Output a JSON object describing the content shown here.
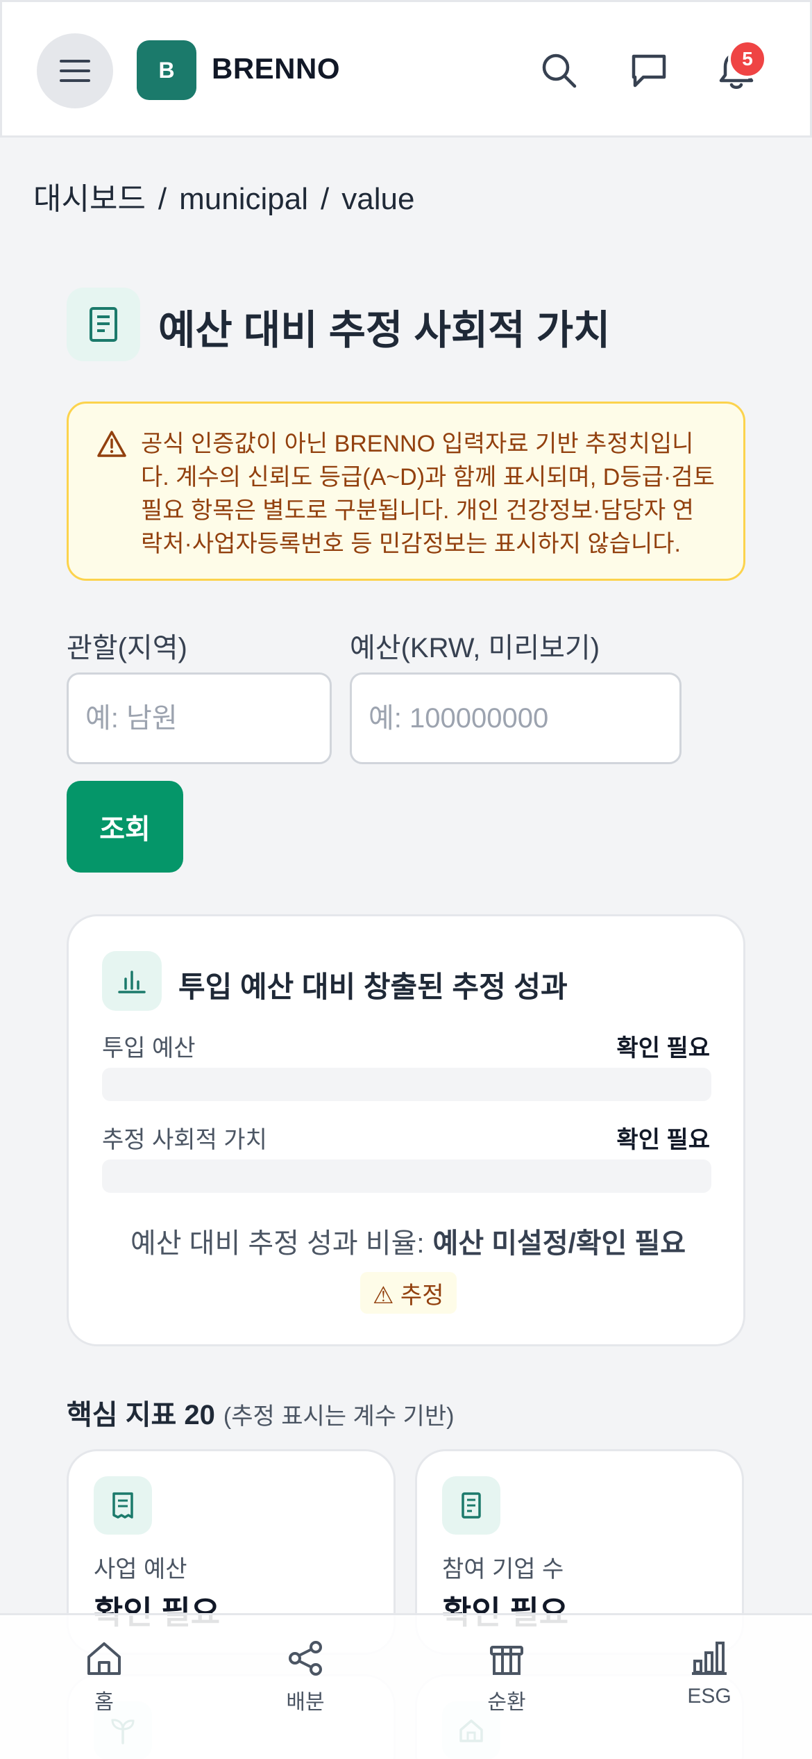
{
  "header": {
    "brand_initial": "B",
    "brand_name": "BRENNO",
    "notification_count": "5"
  },
  "breadcrumb": [
    "대시보드",
    "/",
    "municipal",
    "/",
    "value"
  ],
  "page": {
    "title": "예산 대비 추정 사회적 가치"
  },
  "warning": {
    "text": "공식 인증값이 아닌 BRENNO 입력자료 기반 추정치입니다. 계수의 신뢰도 등급(A~D)과 함께 표시되며, D등급·검토 필요 항목은 별도로 구분됩니다. 개인 건강정보·담당자 연락처·사업자등록번호 등 민감정보는 표시하지 않습니다."
  },
  "form": {
    "region_label": "관할(지역)",
    "region_placeholder": "예: 남원",
    "budget_label": "예산(KRW, 미리보기)",
    "budget_placeholder": "예: 100000000",
    "submit_label": "조회"
  },
  "performance": {
    "title": "투입 예산 대비 창출된 추정 성과",
    "budget_label": "투입 예산",
    "budget_value": "확인 필요",
    "value_label": "추정 사회적 가치",
    "value_value": "확인 필요",
    "ratio_label": "예산 대비 추정 성과 비율:",
    "ratio_value": "예산 미설정/확인 필요",
    "estimate_chip": "⚠ 추정"
  },
  "metrics": {
    "title": "핵심 지표 20",
    "subtitle": "(추정 표시는 계수 기반)",
    "items": [
      {
        "label": "사업 예산",
        "value": "확인 필요"
      },
      {
        "label": "참여 기업 수",
        "value": "확인 필요"
      }
    ]
  },
  "bottom_nav": [
    {
      "label": "홈"
    },
    {
      "label": "배분"
    },
    {
      "label": "순환"
    },
    {
      "label": "ESG"
    }
  ],
  "colors": {
    "brand": "#1b7a6b",
    "accent": "#059669",
    "warning_bg": "#fefce8",
    "warning_text": "#92400e",
    "badge": "#ef4444"
  }
}
